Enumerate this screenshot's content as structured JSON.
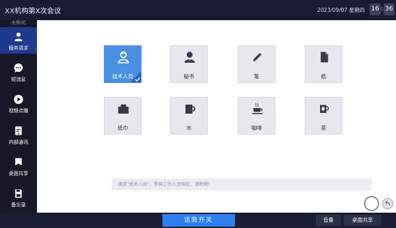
{
  "header": {
    "title": "XX机构第X次会议",
    "date": "2023/09/07 星期四",
    "time_hour": "16",
    "time_minute": "36"
  },
  "sidebar": {
    "partial_top_label": "无纸化",
    "items": [
      {
        "label": "服务请求",
        "icon": "person-icon",
        "active": true
      },
      {
        "label": "短消息",
        "icon": "chat-bubble-icon",
        "active": false
      },
      {
        "label": "视频点播",
        "icon": "play-icon",
        "active": false
      },
      {
        "label": "内部通讯",
        "icon": "contacts-icon",
        "active": false
      },
      {
        "label": "桌面共享",
        "icon": "share-screen-icon",
        "active": false
      },
      {
        "label": "备忘录",
        "icon": "memo-icon",
        "active": false
      }
    ]
  },
  "services": [
    {
      "label": "技术人员",
      "icon": "technician-icon",
      "selected": true
    },
    {
      "label": "秘书",
      "icon": "secretary-icon",
      "selected": false
    },
    {
      "label": "笔",
      "icon": "pen-icon",
      "selected": false
    },
    {
      "label": "纸",
      "icon": "paper-icon",
      "selected": false
    },
    {
      "label": "纸巾",
      "icon": "tissue-icon",
      "selected": false
    },
    {
      "label": "水",
      "icon": "water-cup-icon",
      "selected": false
    },
    {
      "label": "咖啡",
      "icon": "coffee-icon",
      "selected": false
    },
    {
      "label": "茶",
      "icon": "tea-icon",
      "selected": false
    }
  ],
  "hint": "请求\"技术人员\"，等待工作人员响应，请稍候!",
  "bottom": {
    "mic_label": "话筒开关",
    "volume_label": "音量",
    "share_label": "桌面共享"
  },
  "colors": {
    "accent": "#2d7ef0",
    "selected_tile": "#4a90e2",
    "sidebar_active": "#1e3a8f",
    "header_bg": "#1a1c33"
  }
}
